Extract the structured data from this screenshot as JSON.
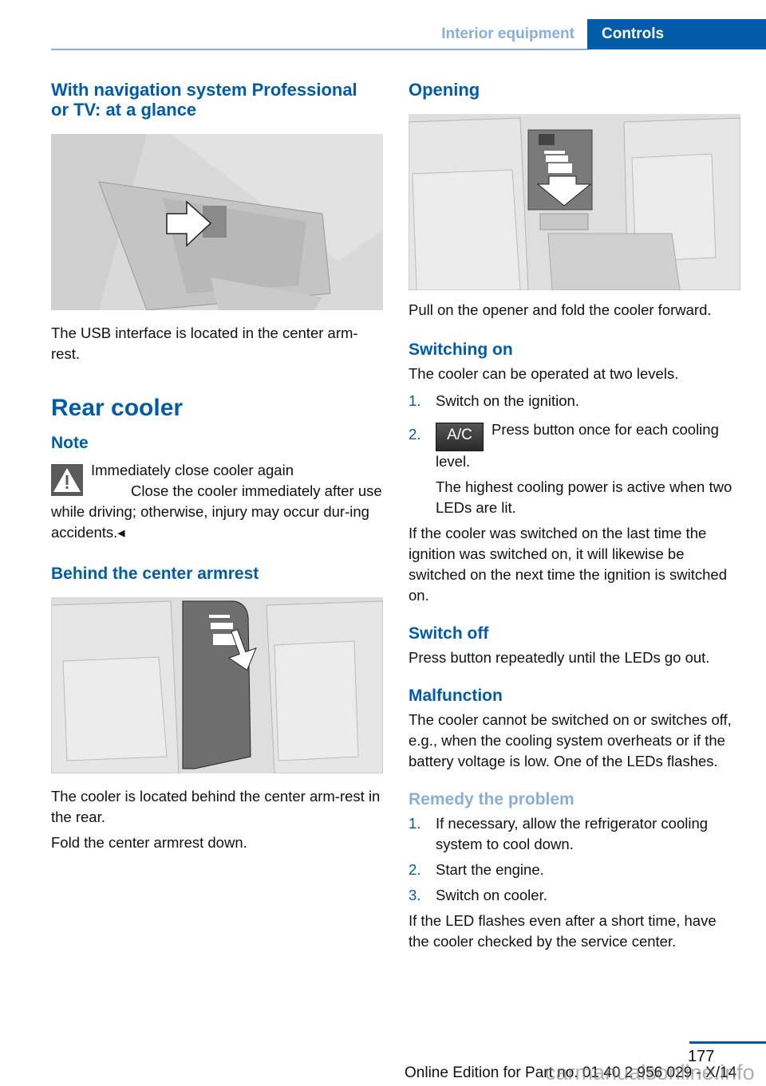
{
  "header": {
    "section": "Interior equipment",
    "tab": "Controls"
  },
  "left": {
    "usb_heading": "With navigation system Professional or TV: at a glance",
    "usb_figure_alt": "USB interface in center armrest",
    "usb_text": "The USB interface is located in the center arm-rest.",
    "rear_cooler_title": "Rear cooler",
    "note_heading": "Note",
    "warning_title": "Immediately close cooler again",
    "warning_text": "Close the cooler immediately after use while driving; otherwise, injury may occur dur-ing accidents.◂",
    "behind_heading": "Behind the center armrest",
    "behind_figure_alt": "Cooler behind rear center armrest",
    "behind_text1": "The cooler is located behind the center arm-rest in the rear.",
    "behind_text2": "Fold the center armrest down."
  },
  "right": {
    "opening_heading": "Opening",
    "opening_figure_alt": "Opening the cooler",
    "opening_text": "Pull on the opener and fold the cooler forward.",
    "switching_on_heading": "Switching on",
    "switching_on_text": "The cooler can be operated at two levels.",
    "switching_on_steps": [
      {
        "num": "1.",
        "text": "Switch on the ignition."
      },
      {
        "num": "2.",
        "button": "A/C",
        "text": "Press button once for each cooling level.",
        "sub": "The highest cooling power is active when two LEDs are lit."
      }
    ],
    "switching_on_after": "If the cooler was switched on the last time the ignition was switched on, it will likewise be switched on the next time the ignition is switched on.",
    "switch_off_heading": "Switch off",
    "switch_off_text": "Press button repeatedly until the LEDs go out.",
    "malfunction_heading": "Malfunction",
    "malfunction_text": "The cooler cannot be switched on or switches off, e.g., when the cooling system overheats or if the battery voltage is low. One of the LEDs flashes.",
    "remedy_heading": "Remedy the problem",
    "remedy_steps": [
      {
        "num": "1.",
        "text": "If necessary, allow the refrigerator cooling system to cool down."
      },
      {
        "num": "2.",
        "text": "Start the engine."
      },
      {
        "num": "3.",
        "text": "Switch on cooler."
      }
    ],
    "remedy_after": "If the LED flashes even after a short time, have the cooler checked by the service center."
  },
  "footer": {
    "page_number": "177",
    "edition": "Online Edition for Part no. 01 40 2 956 029 - X/14",
    "watermark": "carmanualsonline.info"
  },
  "colors": {
    "brand_blue": "#005ca9",
    "light_blue": "#8aaed6"
  }
}
